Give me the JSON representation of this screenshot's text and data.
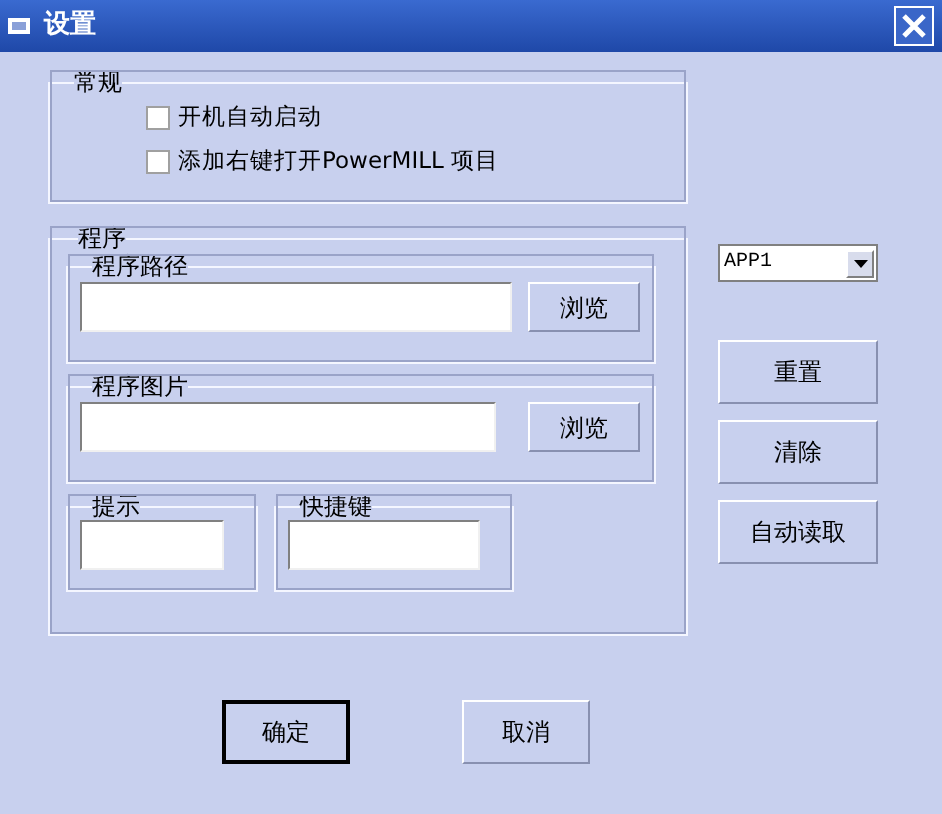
{
  "window": {
    "title": "设置"
  },
  "general": {
    "legend": "常规",
    "options": [
      {
        "label": "开机自动启动",
        "checked": false
      },
      {
        "label": "添加右键打开PowerMILL 项目",
        "checked": false
      }
    ]
  },
  "program": {
    "legend": "程序",
    "path": {
      "legend": "程序路径",
      "button": "浏览"
    },
    "image": {
      "legend": "程序图片",
      "button": "浏览"
    },
    "hint": {
      "legend": "提示"
    },
    "hotkey": {
      "legend": "快捷键"
    }
  },
  "app_select": {
    "value": "APP1"
  },
  "side_buttons": [
    "重置",
    "清除",
    "自动读取"
  ],
  "dialog_buttons": [
    {
      "label": "确定",
      "default": true
    },
    {
      "label": "取消",
      "default": false
    }
  ]
}
